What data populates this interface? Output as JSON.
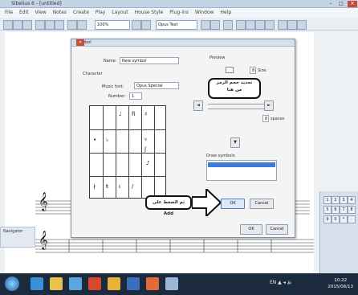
{
  "window": {
    "title": "Sibelius 6 - [untitled]"
  },
  "menubar": [
    "File",
    "Edit",
    "View",
    "Notes",
    "Create",
    "Play",
    "Layout",
    "House Style",
    "Plug-ins",
    "Window",
    "Help"
  ],
  "toolbar": {
    "zoom_value": "100%",
    "font_combo": "Opus Text"
  },
  "dialog": {
    "title": "Symbol",
    "name_label": "Name:",
    "name_value": "New symbol",
    "preview_label": "Preview",
    "character_label": "Character",
    "music_font_label": "Music font:",
    "music_font_value": "Opus Special",
    "number_label": "Number:",
    "number_value": "1",
    "size_label": "Size:",
    "size_value": "8",
    "spaces_label": "spaces",
    "note_spaces_label": "spaces",
    "glyphs": [
      "♩",
      "ﬁ",
      "♯",
      "•",
      "♭",
      "ꝰ",
      "ʃ",
      "♪",
      "∤",
      "ŧ",
      "ι",
      "/"
    ],
    "draw_label": "Draw symbols:",
    "ok_button": "OK",
    "cancel_button": "Cancel",
    "ok_bottom": "OK",
    "cancel_bottom": "Cancel",
    "arrow_buttons": [
      "◄",
      "►",
      "▲",
      "▼"
    ]
  },
  "callout_top": {
    "line1": "تحديد حجم الرمز",
    "line2": "من هنا"
  },
  "callout_bottom": {
    "text": "ثم الضغط على Add"
  },
  "score": {
    "clef": "𝄞"
  },
  "keypad": [
    "1",
    "2",
    "3",
    "4",
    "5",
    "6",
    "7",
    "8",
    "9",
    "0",
    "*",
    "."
  ],
  "left_panel": {
    "label": "Navigator"
  },
  "taskbar": {
    "tray": "EN ▲ ◂ 🔈",
    "time": "10:22",
    "date": "2015/08/13"
  },
  "colors": {
    "dialog_bg": "#f4f4f4",
    "selection": "#3d7bd6",
    "taskbar": "#1c2a3d"
  }
}
